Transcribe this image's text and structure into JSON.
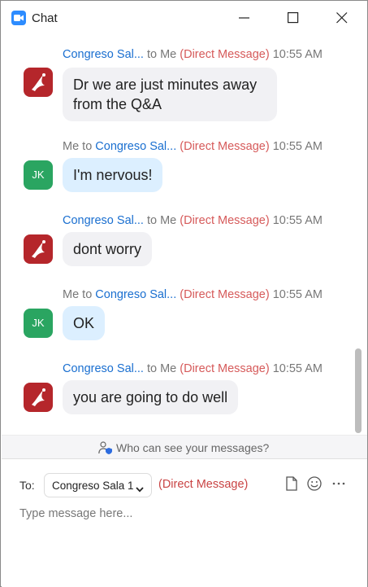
{
  "window": {
    "title": "Chat"
  },
  "messages": [
    {
      "from": "Congreso Sal...",
      "to": "to Me",
      "to_prefix": "",
      "type": "(Direct Message)",
      "time": "10:55 AM",
      "text": "Dr we are just minutes away from the Q&A",
      "direction": "in"
    },
    {
      "from": "Congreso Sal...",
      "to": "",
      "to_prefix": "Me to",
      "type": "(Direct Message)",
      "time": "10:55 AM",
      "text": "I'm nervous!",
      "direction": "out",
      "avatar": "JK"
    },
    {
      "from": "Congreso Sal...",
      "to": "to Me",
      "to_prefix": "",
      "type": "(Direct Message)",
      "time": "10:55 AM",
      "text": "dont worry",
      "direction": "in"
    },
    {
      "from": "Congreso Sal...",
      "to": "",
      "to_prefix": "Me to",
      "type": "(Direct Message)",
      "time": "10:55 AM",
      "text": "OK",
      "direction": "out",
      "avatar": "JK"
    },
    {
      "from": "Congreso Sal...",
      "to": "to Me",
      "to_prefix": "",
      "type": "(Direct Message)",
      "time": "10:55 AM",
      "text": "you are going to do well",
      "direction": "in"
    }
  ],
  "privacy": {
    "text": "Who can see your messages?"
  },
  "compose": {
    "to_label": "To:",
    "recipient": "Congreso Sala 1",
    "recipient_type": "(Direct Message)",
    "placeholder": "Type message here..."
  },
  "colors": {
    "accent": "#2d8cff",
    "name": "#1a6fd0",
    "dm": "#d65a5a",
    "avatar_logo": "#b5262b",
    "avatar_jk": "#2aa561"
  }
}
